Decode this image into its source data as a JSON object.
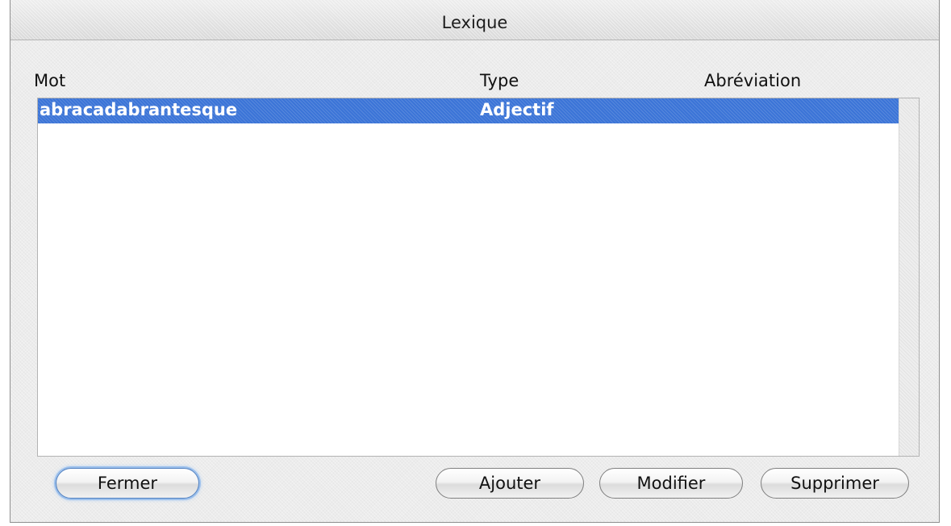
{
  "window": {
    "title": "Lexique"
  },
  "table": {
    "columns": [
      "Mot",
      "Type",
      "Abréviation"
    ],
    "rows": [
      {
        "mot": "abracadabrantesque",
        "type": "Adjectif",
        "abreviation": "",
        "selected": true
      }
    ]
  },
  "buttons": {
    "close": "Fermer",
    "add": "Ajouter",
    "edit": "Modifier",
    "delete": "Supprimer"
  },
  "colors": {
    "selection": "#3b74d7",
    "window_bg": "#ececec"
  }
}
